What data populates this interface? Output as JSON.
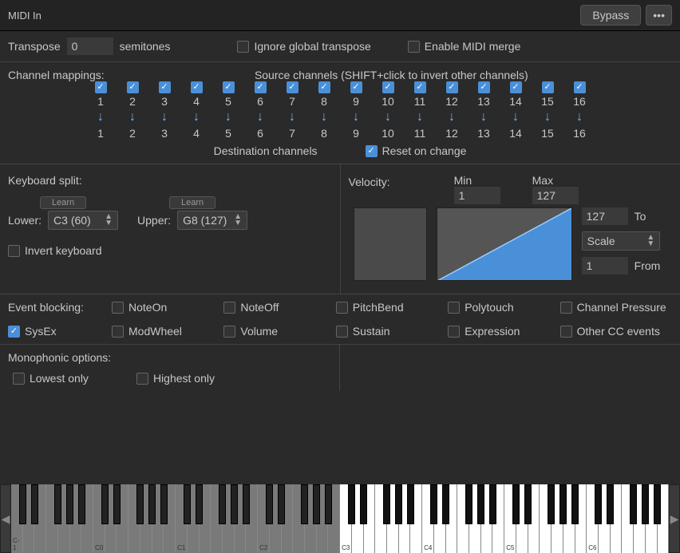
{
  "header": {
    "title": "MIDI In",
    "bypass": "Bypass"
  },
  "transpose": {
    "label": "Transpose",
    "value": "0",
    "unit": "semitones"
  },
  "ignore_global": {
    "label": "Ignore global transpose",
    "checked": false
  },
  "midi_merge": {
    "label": "Enable MIDI merge",
    "checked": false
  },
  "mappings": {
    "label": "Channel mappings:",
    "source_hint": "Source channels (SHIFT+click to invert other channels)",
    "dest_label": "Destination channels",
    "reset": {
      "label": "Reset on change",
      "checked": true
    },
    "channels": [
      {
        "src": "1",
        "dst": "1",
        "on": true
      },
      {
        "src": "2",
        "dst": "2",
        "on": true
      },
      {
        "src": "3",
        "dst": "3",
        "on": true
      },
      {
        "src": "4",
        "dst": "4",
        "on": true
      },
      {
        "src": "5",
        "dst": "5",
        "on": true
      },
      {
        "src": "6",
        "dst": "6",
        "on": true
      },
      {
        "src": "7",
        "dst": "7",
        "on": true
      },
      {
        "src": "8",
        "dst": "8",
        "on": true
      },
      {
        "src": "9",
        "dst": "9",
        "on": true
      },
      {
        "src": "10",
        "dst": "10",
        "on": true
      },
      {
        "src": "11",
        "dst": "11",
        "on": true
      },
      {
        "src": "12",
        "dst": "12",
        "on": true
      },
      {
        "src": "13",
        "dst": "13",
        "on": true
      },
      {
        "src": "14",
        "dst": "14",
        "on": true
      },
      {
        "src": "15",
        "dst": "15",
        "on": true
      },
      {
        "src": "16",
        "dst": "16",
        "on": true
      }
    ]
  },
  "split": {
    "label": "Keyboard split:",
    "learn": "Learn",
    "lower_label": "Lower:",
    "lower_value": "C3 (60)",
    "upper_label": "Upper:",
    "upper_value": "G8 (127)",
    "invert": {
      "label": "Invert keyboard",
      "checked": false
    }
  },
  "velocity": {
    "label": "Velocity:",
    "min_label": "Min",
    "min_value": "1",
    "max_label": "Max",
    "max_value": "127",
    "to_label": "To",
    "to_value": "127",
    "mode": "Scale",
    "from_label": "From",
    "from_value": "1"
  },
  "blocking": {
    "label": "Event blocking:",
    "items": [
      {
        "name": "NoteOn",
        "checked": false
      },
      {
        "name": "NoteOff",
        "checked": false
      },
      {
        "name": "PitchBend",
        "checked": false
      },
      {
        "name": "Polytouch",
        "checked": false
      },
      {
        "name": "Channel Pressure",
        "checked": false
      },
      {
        "name": "SysEx",
        "checked": true
      },
      {
        "name": "ModWheel",
        "checked": false
      },
      {
        "name": "Volume",
        "checked": false
      },
      {
        "name": "Sustain",
        "checked": false
      },
      {
        "name": "Expression",
        "checked": false
      },
      {
        "name": "Other CC events",
        "checked": false
      }
    ]
  },
  "mono": {
    "label": "Monophonic options:",
    "lowest": {
      "label": "Lowest only",
      "checked": false
    },
    "highest": {
      "label": "Highest only",
      "checked": false
    }
  },
  "keyboard": {
    "oct_labels": [
      "C-1",
      "C0",
      "C1",
      "C2",
      "C3",
      "C4",
      "C5",
      "C6"
    ],
    "active_from_white_index": 28,
    "white_count": 56
  }
}
